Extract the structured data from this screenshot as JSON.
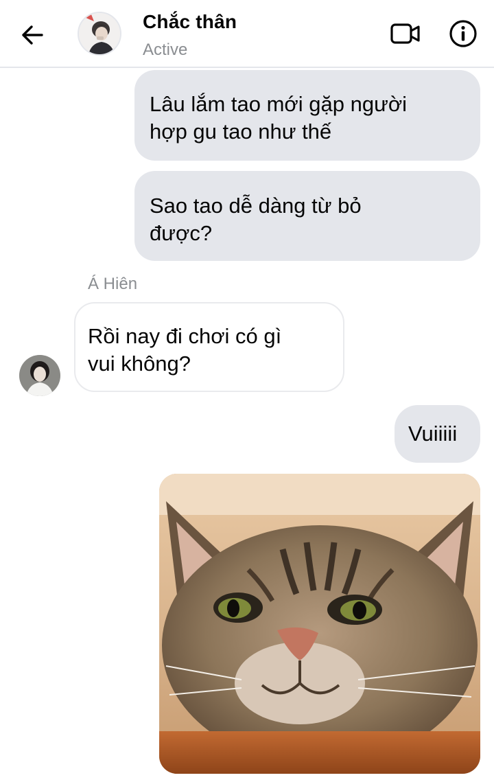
{
  "header": {
    "title": "Chắc thân",
    "status": "Active",
    "icons": {
      "back": "arrow-left-icon",
      "video": "video-call-icon",
      "info": "info-icon"
    }
  },
  "messages": [
    {
      "from": "me",
      "text": "Lâu lắm tao mới gặp người\nhợp gu tao như thế"
    },
    {
      "from": "me",
      "text": "Sao tao dễ dàng từ bỏ\nđược?"
    },
    {
      "from": "them",
      "sender": "Á Hiên",
      "text": "Rồi nay đi chơi có gì\nvui không?"
    },
    {
      "from": "me",
      "text": "Vuiiiii"
    },
    {
      "from": "me",
      "type": "image",
      "image": "smiling-cat-photo"
    }
  ],
  "colors": {
    "outgoing_bubble": "#e4e6eb",
    "incoming_bubble": "#ffffff",
    "muted_text": "#8a8d91",
    "text": "#050505"
  }
}
